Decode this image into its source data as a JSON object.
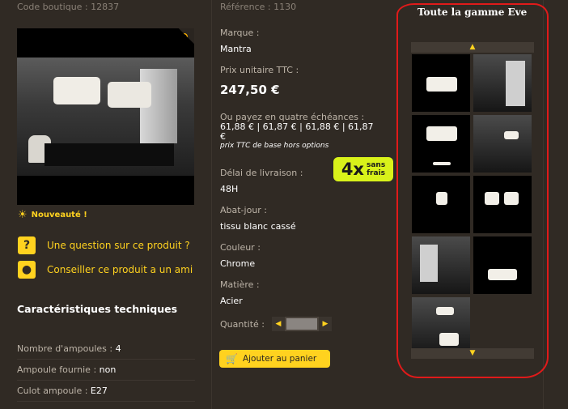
{
  "left": {
    "code_boutique": "Code boutique : 12837",
    "badge_nouveau": "Nouveauté !",
    "action_question": "Une question sur ce produit ?",
    "action_conseiller": "Conseiller ce produit a un ami",
    "tech_title": "Caractéristiques techniques",
    "specs": [
      {
        "key": "Nombre d'ampoules :",
        "value": "4"
      },
      {
        "key": "Ampoule fournie :",
        "value": "non"
      },
      {
        "key": "Culot ampoule :",
        "value": "E27"
      }
    ]
  },
  "middle": {
    "reference": "Référence : 1130",
    "marque_label": "Marque :",
    "marque_value": "Mantra",
    "prix_label": "Prix unitaire TTC :",
    "prix_value": "247,50 €",
    "pay4_label": "Ou payez en quatre échéances :",
    "pay4_values": "61,88 € | 61,87 € | 61,88 € | 61,87 €",
    "pay4_note": "prix TTC de base hors options",
    "delai_label": "Délai de livraison :",
    "delai_value": "48H",
    "abat_label": "Abat-jour :",
    "abat_value": "tissu blanc cassé",
    "couleur_label": "Couleur :",
    "couleur_value": "Chrome",
    "matiere_label": "Matière :",
    "matiere_value": "Acier",
    "quantite_label": "Quantité :",
    "badge_4x_big": "4x",
    "badge_4x_small1": "sans",
    "badge_4x_small2": "frais",
    "add_to_cart": "Ajouter au panier"
  },
  "right": {
    "range_title": "Toute la gamme Eve"
  },
  "colors": {
    "background": "#302a24",
    "accent": "#ffd21f",
    "badge_green": "#d9f21a",
    "annotation_red": "#e01a1a"
  },
  "icons": {
    "zoom": "magnifier-icon",
    "nouveau": "sun-icon",
    "question": "question-icon",
    "conseiller": "chat-bubble-icon",
    "cart": "cart-icon"
  }
}
